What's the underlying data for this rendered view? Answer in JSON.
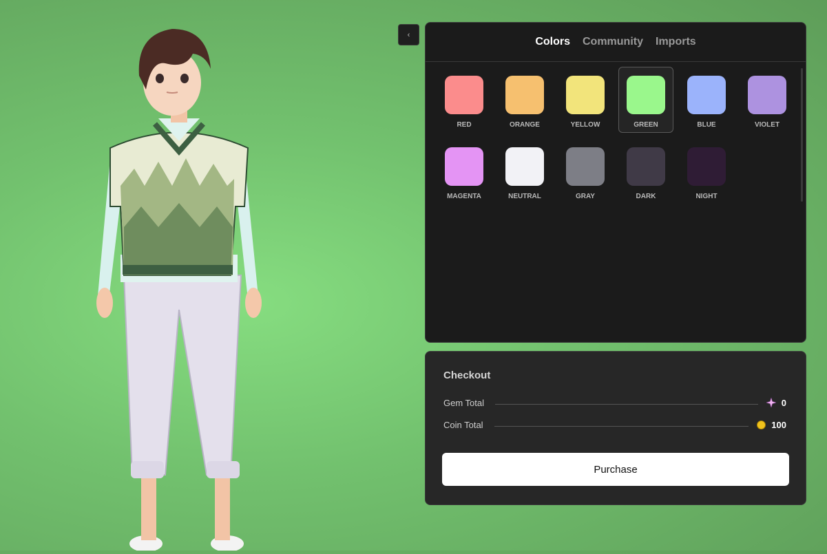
{
  "tabs": [
    {
      "label": "Colors",
      "active": true
    },
    {
      "label": "Community",
      "active": false
    },
    {
      "label": "Imports",
      "active": false
    }
  ],
  "collapse_icon": "chevron-left-icon",
  "colors": [
    {
      "label": "RED",
      "hex": "#fb8c8c",
      "selected": false
    },
    {
      "label": "ORANGE",
      "hex": "#f6c06f",
      "selected": false
    },
    {
      "label": "YELLOW",
      "hex": "#f2e47b",
      "selected": false
    },
    {
      "label": "GREEN",
      "hex": "#9af78c",
      "selected": true
    },
    {
      "label": "BLUE",
      "hex": "#9bb3fb",
      "selected": false
    },
    {
      "label": "VIOLET",
      "hex": "#ad92e0",
      "selected": false
    },
    {
      "label": "MAGENTA",
      "hex": "#e494f4",
      "selected": false
    },
    {
      "label": "NEUTRAL",
      "hex": "#f2f2f6",
      "selected": false
    },
    {
      "label": "GRAY",
      "hex": "#7d7e86",
      "selected": false
    },
    {
      "label": "DARK",
      "hex": "#403a47",
      "selected": false
    },
    {
      "label": "NIGHT",
      "hex": "#2f1c35",
      "selected": false
    }
  ],
  "checkout": {
    "title": "Checkout",
    "gem_label": "Gem Total",
    "gem_value": "0",
    "gem_icon": "gem-sparkle-icon",
    "coin_label": "Coin Total",
    "coin_value": "100",
    "coin_icon": "coin-icon",
    "purchase_label": "Purchase"
  },
  "background_color": "#7fd179"
}
